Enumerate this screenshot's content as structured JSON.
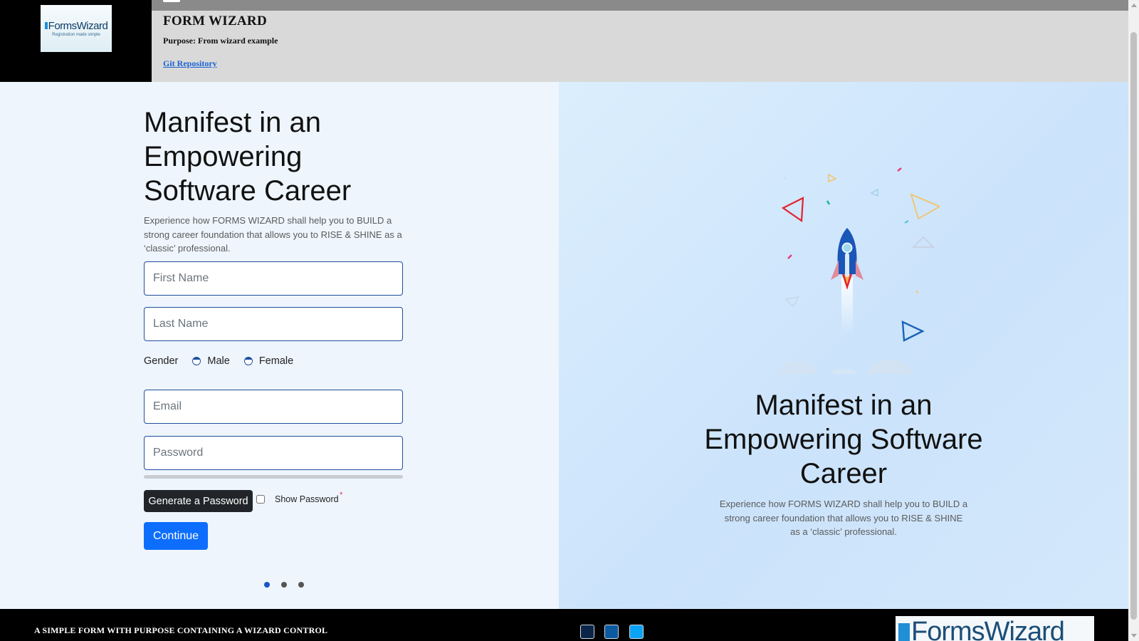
{
  "header": {
    "logo_text": "FormsWizard",
    "logo_tagline": "Registration made simple",
    "title": "FORM WIZARD",
    "purpose": "Purpose: From wizard example",
    "repo_link": "Git Repository"
  },
  "form_panel": {
    "heading": "Manifest in an Empowering Software Career",
    "description": "Experience how FORMS WIZARD shall help you to BUILD a strong career foundation that allows you to RISE & SHINE as a ‘classic’ professional.",
    "first_name_placeholder": "First Name",
    "last_name_placeholder": "Last Name",
    "gender_label": "Gender",
    "gender_options": [
      "Male",
      "Female"
    ],
    "email_placeholder": "Email",
    "password_placeholder": "Password",
    "generate_password_label": "Generate a Password",
    "show_password_label": "Show Password",
    "required_marker": "*",
    "continue_label": "Continue",
    "steps_total": 3,
    "active_step": 1
  },
  "illustration_panel": {
    "heading": "Manifest in an Empowering Software Career",
    "description": "Experience how FORMS WIZARD shall help you to BUILD a strong career foundation that allows you to RISE & SHINE as a ‘classic’ professional."
  },
  "footer": {
    "tagline": "A SIMPLE FORM WITH PURPOSE CONTAINING A WIZARD CONTROL",
    "social_icons": [
      "social-icon-navy",
      "social-icon-blue",
      "social-icon-sky"
    ],
    "logo_text": "FormsWizard"
  },
  "colors": {
    "primary": "#0d6efd",
    "dark_button": "#212529",
    "input_border": "#1f4e9a",
    "footer_bg": "#000000",
    "social_navy": "#0b2447",
    "social_blue": "#0a5aa0",
    "social_sky": "#0aa2f5"
  }
}
